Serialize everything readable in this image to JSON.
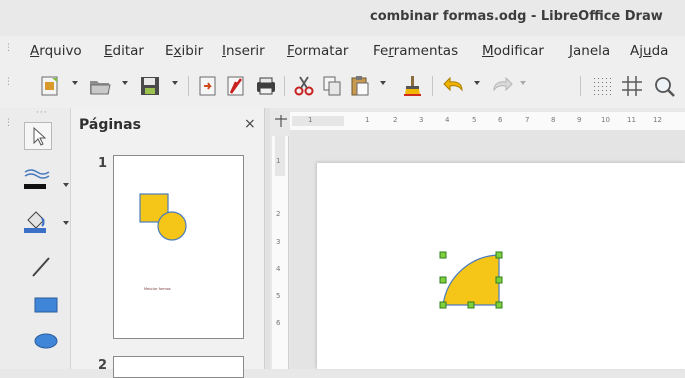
{
  "window": {
    "title": "combinar formas.odg - LibreOffice Draw"
  },
  "menu": {
    "items": [
      {
        "pre": "",
        "acc": "A",
        "post": "rquivo"
      },
      {
        "pre": "",
        "acc": "E",
        "post": "ditar"
      },
      {
        "pre": "E",
        "acc": "x",
        "post": "ibir"
      },
      {
        "pre": "",
        "acc": "I",
        "post": "nserir"
      },
      {
        "pre": "",
        "acc": "F",
        "post": "ormatar"
      },
      {
        "pre": "Fe",
        "acc": "r",
        "post": "ramentas"
      },
      {
        "pre": "",
        "acc": "M",
        "post": "odificar"
      },
      {
        "pre": "",
        "acc": "J",
        "post": "anela"
      },
      {
        "pre": "Aj",
        "acc": "u",
        "post": "da"
      }
    ]
  },
  "toolbar": {
    "icons": [
      "new-icon",
      "open-icon",
      "save-icon",
      "export-icon",
      "export-pdf-icon",
      "print-icon",
      "cut-icon",
      "copy-icon",
      "paste-icon",
      "clone-formatting-icon",
      "undo-icon",
      "redo-icon",
      "grid-icon",
      "helplines-icon",
      "zoom-icon"
    ]
  },
  "pages_pane": {
    "title": "Páginas",
    "close_label": "×",
    "pages": [
      {
        "number": "1",
        "caption": "Mesclar formas"
      },
      {
        "number": "2"
      }
    ]
  },
  "ruler": {
    "h_ticks": [
      "1",
      "1",
      "2",
      "3",
      "4",
      "5",
      "6",
      "7",
      "8",
      "9",
      "10",
      "11",
      "12"
    ],
    "v_ticks": [
      "1",
      "2",
      "3",
      "4",
      "5",
      "6"
    ]
  },
  "colors": {
    "shape_fill": "#f5c518",
    "shape_stroke": "#4a7bbf",
    "handle_fill": "#7fd13b",
    "handle_stroke": "#2f7d1d",
    "accent": "#f5c518"
  }
}
